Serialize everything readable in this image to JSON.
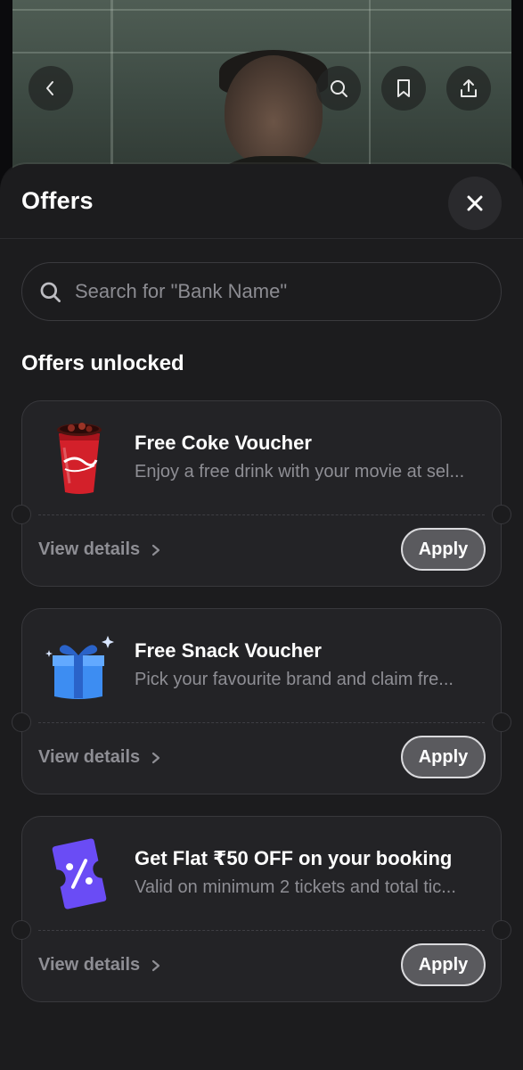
{
  "hero": {
    "buttons": [
      {
        "icon": "back-arrow-icon"
      },
      {
        "icon": "search-icon"
      },
      {
        "icon": "bookmark-icon"
      },
      {
        "icon": "share-icon"
      }
    ]
  },
  "sheet": {
    "title": "Offers",
    "close_icon": "close-icon",
    "search": {
      "placeholder": "Search for \"Bank Name\"",
      "value": ""
    },
    "section_title": "Offers unlocked",
    "offers": [
      {
        "title": "Free Coke Voucher",
        "description": "Enjoy a free drink with your movie at sel...",
        "icon": "coke-cup-icon",
        "details_label": "View details",
        "apply_label": "Apply"
      },
      {
        "title": "Free Snack Voucher",
        "description": "Pick your favourite brand and claim fre...",
        "icon": "gift-box-icon",
        "details_label": "View details",
        "apply_label": "Apply"
      },
      {
        "title": "Get Flat ₹50 OFF on your booking",
        "description": "Valid on minimum 2 tickets and total tic...",
        "icon": "discount-ticket-icon",
        "details_label": "View details",
        "apply_label": "Apply"
      }
    ]
  },
  "colors": {
    "sheet_bg": "#1c1c1e",
    "card_bg": "#232326",
    "ticket_purple": "#6a4cf5",
    "gift_blue": "#3d8df2",
    "coke_red": "#d3202a"
  }
}
